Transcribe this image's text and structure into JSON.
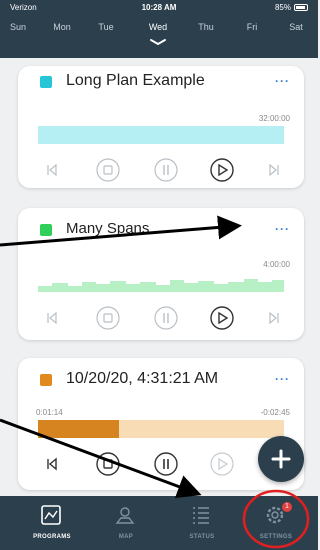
{
  "status_bar": {
    "carrier": "Verizon",
    "time": "10:28 AM",
    "battery": "85%"
  },
  "days": [
    {
      "label": "Sun",
      "active": false
    },
    {
      "label": "Mon",
      "active": false
    },
    {
      "label": "Tue",
      "active": false
    },
    {
      "label": "Wed",
      "active": true
    },
    {
      "label": "Thu",
      "active": false
    },
    {
      "label": "Fri",
      "active": false
    },
    {
      "label": "Sat",
      "active": false
    }
  ],
  "programs": [
    {
      "name": "Long Plan Example",
      "color": "#26c6d6",
      "total": "32:00:00",
      "more": "···"
    },
    {
      "name": "Many Spans",
      "color": "#2fcf5a",
      "total": "4:00:00",
      "more": "···"
    },
    {
      "name": "10/20/20, 4:31:21 AM",
      "color": "#e08a1e",
      "elapsed": "0:01:14",
      "remaining": "-0:02:45",
      "progress": 0.33,
      "more": "···"
    }
  ],
  "tabs": [
    {
      "label": "PROGRAMS",
      "icon": "programs-icon",
      "active": true
    },
    {
      "label": "MAP",
      "icon": "map-icon",
      "active": false
    },
    {
      "label": "STATUS",
      "icon": "status-icon",
      "active": false
    },
    {
      "label": "SETTINGS",
      "icon": "settings-icon",
      "active": false,
      "badge": "1"
    }
  ],
  "colors": {
    "nav": "#2c3f4d",
    "accent": "#2f7fd6",
    "annotation_arrow": "#000000",
    "annotation_circle": "#e02020"
  }
}
